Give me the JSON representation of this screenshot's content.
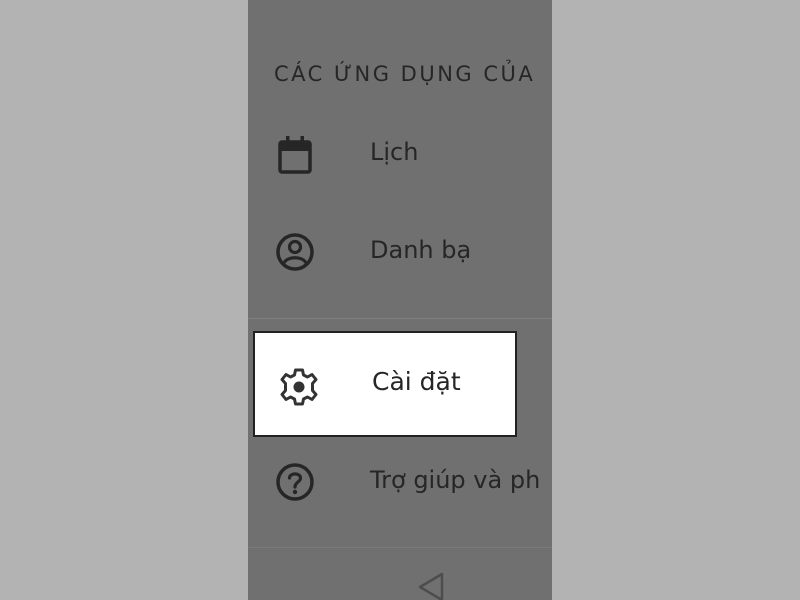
{
  "drawer": {
    "section_header": "CÁC ỨNG DỤNG CỦA",
    "items": [
      {
        "label": "Lịch",
        "icon": "calendar-icon"
      },
      {
        "label": "Danh bạ",
        "icon": "contacts-icon"
      },
      {
        "label": "Trợ giúp và ph",
        "icon": "help-icon"
      }
    ],
    "highlighted_item": {
      "label": "Cài đặt",
      "icon": "settings-gear-icon"
    }
  },
  "nav": {
    "back_icon": "back-triangle-icon"
  },
  "colors": {
    "backdrop": "#b3b3b3",
    "drawer_dimmed": "#707070",
    "text": "#262626",
    "highlight_bg": "#ffffff",
    "highlight_border": "#222222"
  }
}
